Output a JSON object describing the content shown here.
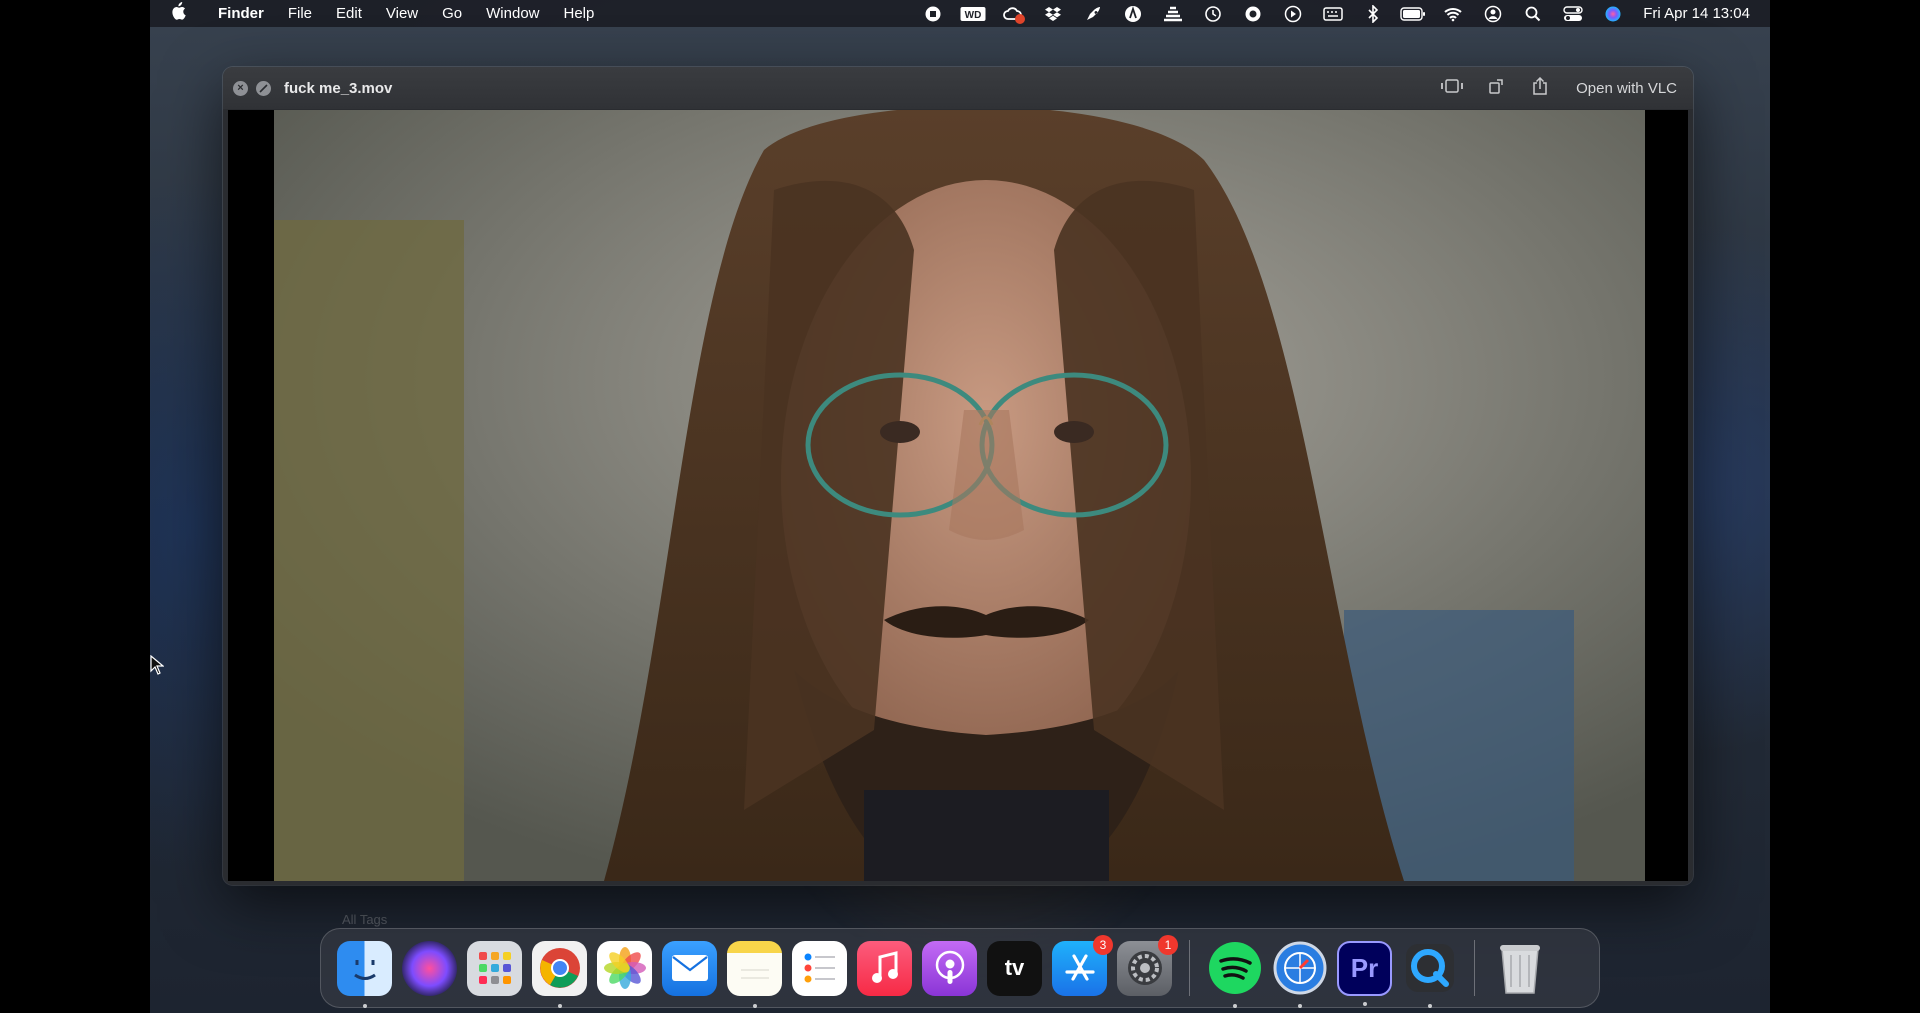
{
  "menubar": {
    "apple_icon": "",
    "app_name": "Finder",
    "menus": [
      "File",
      "Edit",
      "View",
      "Go",
      "Window",
      "Help"
    ],
    "status_icons": [
      "stop-icon",
      "wd-icon",
      "creative-cloud-icon",
      "dropbox-icon",
      "rocket-icon",
      "vpn-icon",
      "stack-icon",
      "time-machine-icon",
      "sync-icon",
      "play-icon",
      "keyboard-icon",
      "bluetooth-icon",
      "battery-icon",
      "wifi-icon",
      "user-icon",
      "search-icon",
      "control-center-icon",
      "siri-icon"
    ],
    "dropbox_badge": "1",
    "clock": "Fri Apr 14  13:04"
  },
  "quicklook": {
    "filename": "fuck me_3.mov",
    "open_with": "Open with VLC"
  },
  "background": {
    "sidebar_hint": "All Tags"
  },
  "dock": {
    "items": [
      {
        "name": "finder",
        "running": true
      },
      {
        "name": "siri",
        "running": false
      },
      {
        "name": "launchpad",
        "running": false
      },
      {
        "name": "chrome",
        "running": true
      },
      {
        "name": "photos",
        "running": false
      },
      {
        "name": "mail",
        "running": false
      },
      {
        "name": "notes",
        "running": true
      },
      {
        "name": "reminders",
        "running": false
      },
      {
        "name": "music",
        "running": false
      },
      {
        "name": "podcasts",
        "running": false
      },
      {
        "name": "apple-tv",
        "running": false,
        "label": "tv"
      },
      {
        "name": "app-store",
        "running": false,
        "badge": "3"
      },
      {
        "name": "system-settings",
        "running": false,
        "badge": "1"
      },
      {
        "name": "spotify",
        "running": true
      },
      {
        "name": "proxyman",
        "running": true
      },
      {
        "name": "premiere-pro",
        "running": true,
        "label": "Pr"
      },
      {
        "name": "quicktime",
        "running": true
      },
      {
        "name": "trash",
        "running": false
      }
    ]
  },
  "colors": {
    "menubar": "#1e2128",
    "window": "#2a2c30",
    "accent_red": "#f0372d"
  }
}
